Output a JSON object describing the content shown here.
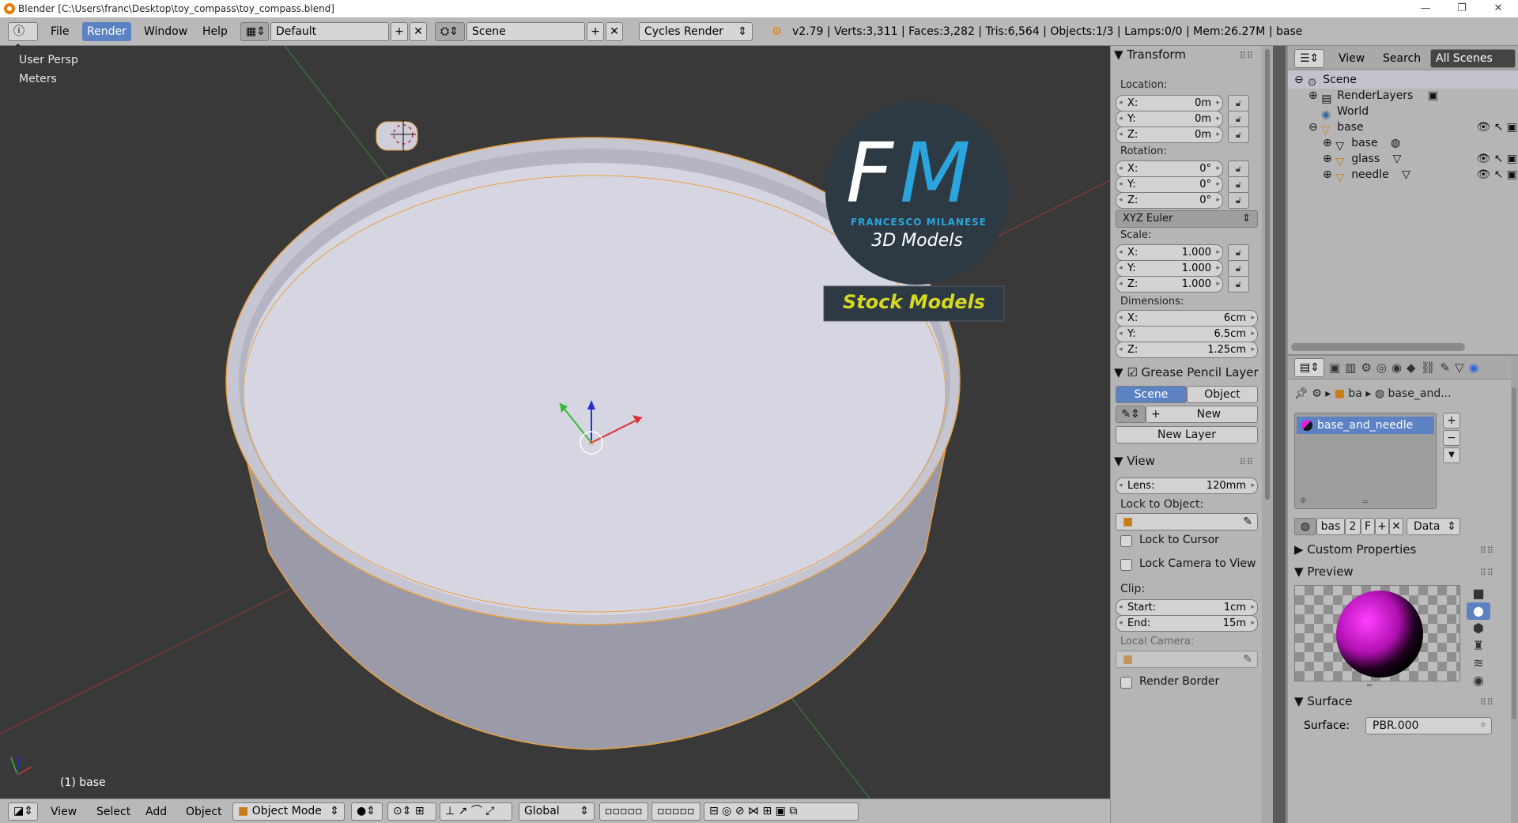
{
  "window": {
    "title": "Blender [C:\\Users\\franc\\Desktop\\toy_compass\\toy_compass.blend]",
    "minimize": "—",
    "maximize": "❐",
    "close": "✕"
  },
  "header": {
    "menus": [
      "File",
      "Render",
      "Window",
      "Help"
    ],
    "screen_layout": "Default",
    "scene": "Scene",
    "render_engine": "Cycles Render",
    "stats": "v2.79 | Verts:3,311 | Faces:3,282 | Tris:6,564 | Objects:1/3 | Lamps:0/0 | Mem:26.27M | base"
  },
  "viewport": {
    "view_name": "User Persp",
    "units": "Meters",
    "active_object": "(1) base",
    "watermark": {
      "initials_f": "F",
      "initials_m": "M",
      "name": "FRANCESCO MILANESE",
      "tagline": "3D Models",
      "banner": "Stock Models"
    }
  },
  "bottom_toolbar": {
    "menus": [
      "View",
      "Select",
      "Add",
      "Object"
    ],
    "mode": "Object Mode",
    "orientation": "Global"
  },
  "transform": {
    "title": "Transform",
    "location_label": "Location:",
    "location": [
      {
        "k": "X:",
        "v": "0m"
      },
      {
        "k": "Y:",
        "v": "0m"
      },
      {
        "k": "Z:",
        "v": "0m"
      }
    ],
    "rotation_label": "Rotation:",
    "rotation": [
      {
        "k": "X:",
        "v": "0°"
      },
      {
        "k": "Y:",
        "v": "0°"
      },
      {
        "k": "Z:",
        "v": "0°"
      }
    ],
    "rotation_mode": "XYZ Euler",
    "scale_label": "Scale:",
    "scale": [
      {
        "k": "X:",
        "v": "1.000"
      },
      {
        "k": "Y:",
        "v": "1.000"
      },
      {
        "k": "Z:",
        "v": "1.000"
      }
    ],
    "dimensions_label": "Dimensions:",
    "dimensions": [
      {
        "k": "X:",
        "v": "6cm"
      },
      {
        "k": "Y:",
        "v": "6.5cm"
      },
      {
        "k": "Z:",
        "v": "1.25cm"
      }
    ]
  },
  "grease_pencil": {
    "title": "Grease Pencil Layer",
    "tab_scene": "Scene",
    "tab_object": "Object",
    "new": "New",
    "new_layer": "New Layer"
  },
  "view_panel": {
    "title": "View",
    "lens_label": "Lens:",
    "lens": "120mm",
    "lock_to_object": "Lock to Object:",
    "lock_to_cursor": "Lock to Cursor",
    "lock_camera": "Lock Camera to View",
    "clip_label": "Clip:",
    "clip_start_label": "Start:",
    "clip_start": "1cm",
    "clip_end_label": "End:",
    "clip_end": "15m",
    "local_camera": "Local Camera:",
    "render_border": "Render Border"
  },
  "outliner": {
    "menu_view": "View",
    "menu_search": "Search",
    "filter": "All Scenes",
    "items": [
      "Scene",
      "RenderLayers",
      "World",
      "base",
      "base",
      "glass",
      "needle"
    ]
  },
  "properties": {
    "path_object": "ba",
    "path_material": "base_and...",
    "material_slot": "base_and_needle",
    "material_name": "bas",
    "users": "2",
    "fake": "F",
    "link": "Data",
    "custom_properties": "Custom Properties",
    "preview": "Preview",
    "surface_title": "Surface",
    "surface_label": "Surface:",
    "surface_value": "PBR.000"
  },
  "colors": {
    "accent": "#5c82c4",
    "viewport_bg": "#393939",
    "panel_bg": "#b5b5b5",
    "selection_outline": "#e8a040",
    "watermark_blue": "#2aa5de",
    "banner_yellow": "#d8d820"
  }
}
